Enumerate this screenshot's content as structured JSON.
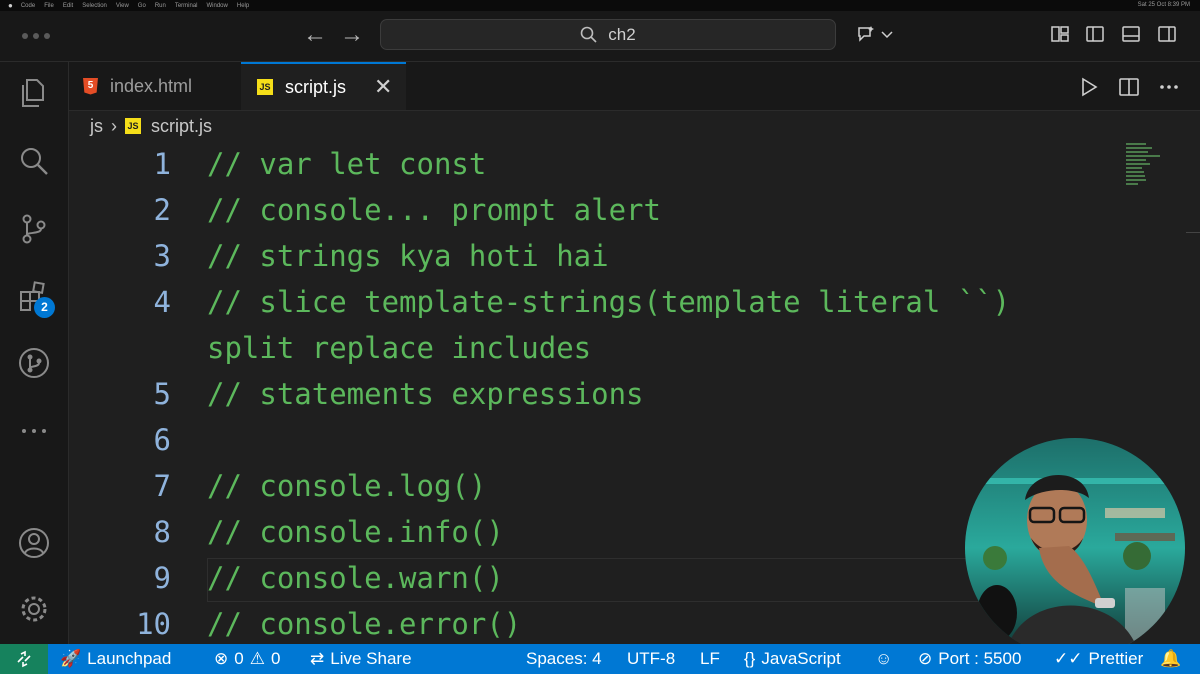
{
  "menubar": {
    "items": [
      "Code",
      "File",
      "Edit",
      "Selection",
      "View",
      "Go",
      "Run",
      "Terminal",
      "Window",
      "Help"
    ],
    "clock": "Sat 25 Oct 8:39 PM"
  },
  "titlebar": {
    "search_text": "ch2"
  },
  "activity_bar": {
    "extensions_badge": "2"
  },
  "tabs": [
    {
      "label": "index.html",
      "icon": "html5-file-icon",
      "active": false
    },
    {
      "label": "script.js",
      "icon": "js-file-icon",
      "active": true
    }
  ],
  "breadcrumb": {
    "folder": "js",
    "file": "script.js",
    "file_icon_text": "JS"
  },
  "editor": {
    "lines": [
      {
        "num": "1",
        "text": "// var let const"
      },
      {
        "num": "2",
        "text": "// console... prompt alert"
      },
      {
        "num": "3",
        "text": "// strings kya hoti hai"
      },
      {
        "num": "4",
        "text": "// slice template-strings(template literal ``)"
      },
      {
        "num": "",
        "text": "split replace includes"
      },
      {
        "num": "5",
        "text": "// statements expressions"
      },
      {
        "num": "6",
        "text": ""
      },
      {
        "num": "7",
        "text": "// console.log()"
      },
      {
        "num": "8",
        "text": "// console.info()"
      },
      {
        "num": "9",
        "text": "// console.warn()"
      },
      {
        "num": "10",
        "text": "// console.error()"
      }
    ],
    "comment_color": "#5cb85c",
    "line_number_color": "#8fb3dc"
  },
  "statusbar": {
    "launchpad": "Launchpad",
    "errors": "0",
    "warnings": "0",
    "live_share": "Live Share",
    "spaces": "Spaces: 4",
    "encoding": "UTF-8",
    "eol": "LF",
    "language": "JavaScript",
    "port": "Port : 5500",
    "prettier": "Prettier",
    "background": "#0078d4"
  }
}
